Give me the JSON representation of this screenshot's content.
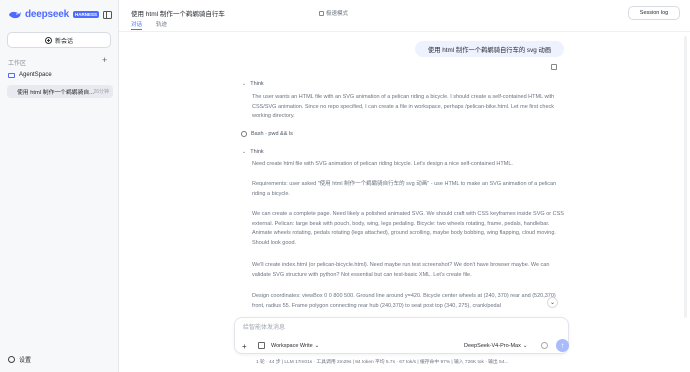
{
  "sidebar": {
    "brand": "deepseek",
    "brand_badge": "HARNESS",
    "new_chat": "新会话",
    "workspace_label": "工作区",
    "workspace_add": "+",
    "folder": "AgentSpace",
    "session_title": "使用 html 制作一个鹈鹕骑自...",
    "session_time": "26分钟",
    "settings": "设置"
  },
  "header": {
    "title": "使用 html 制作一个鹈鹕骑自行车",
    "mode": "极速模式",
    "tabs": [
      "对话",
      "轨迹"
    ],
    "session_log": "Session log"
  },
  "conversation": {
    "user_message": "使用 html 制作一个鹈鹕骑自行车的 svg 动画",
    "think1_label": "Think",
    "think1_text": "The user wants an HTML file with an SVG animation of a pelican riding a bicycle. I should create a self-contained HTML with CSS/SVG animation. Since no repo specified, I can create a file in workspace, perhaps /pelican-bike.html. Let me first check working directory.",
    "bash_label": "Bash · pwd && ls",
    "think2_label": "Think",
    "think2_p1": "Need create html file with SVG animation of pelican riding bicycle. Let's design a nice self-contained HTML.",
    "think2_p2": "Requirements: user asked \"使用 html 制作一个鹈鹕骑自行车的 svg 动画\" - use HTML to make an SVG animation of a pelican riding a bicycle.",
    "think2_p3": "We can create a complete page. Need likely a polished animated SVG. We should craft with CSS keyframes inside SVG or CSS external. Pelican: large beak with pouch, body, wing, legs pedaling. Bicycle: two wheels rotating, frame, pedals, handlebar. Animate wheels rotating, pedals rotating (legs attached), ground scrolling, maybe body bobbing, wing flapping, cloud moving. Should look good.",
    "think2_p4": "We'll create index.html (or pelican-bicycle.html). Need maybe run test screenshot? We don't have browser maybe. We can validate SVG structure with python? Not essential but can test-basic XML. Let's create file.",
    "think2_p5": "Design coordinates: viewBox 0 0 800 500. Ground line around y=420. Bicycle center wheels at (240, 370) rear and (520,370) front, radius 55. Frame polygon connecting rear hub (240,370) to seat post top (340, 275), crank/pedal"
  },
  "composer": {
    "placeholder": "给智能体发消息",
    "plus": "+",
    "mode": "Workspace Write",
    "model": "DeepSeek-V4-Pro-Max",
    "send": "↑"
  },
  "statusbar": "1 轮 · 44 步 | LLM 17m01s · 工具调用 2m29s | 84 token 平均 5.7s · 67 tok/s | 缓存命中 97% | 输入 726K tok · 输出 54..."
}
